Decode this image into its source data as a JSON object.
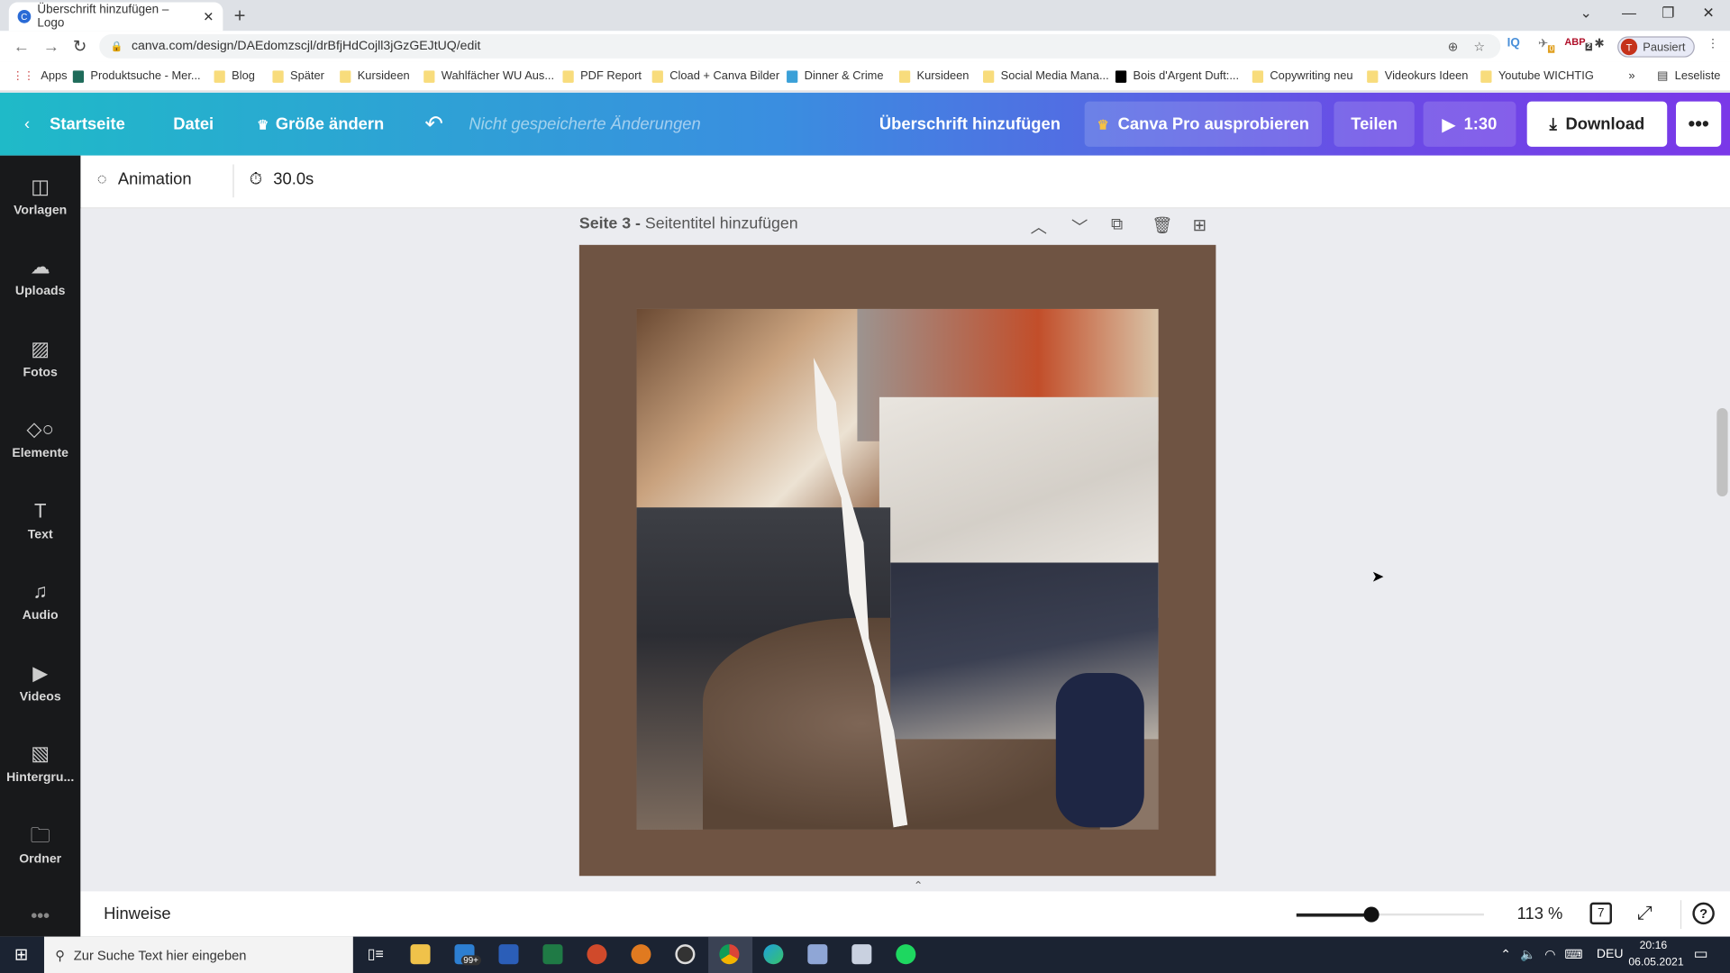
{
  "browser": {
    "tab_title": "Überschrift hinzufügen – Logo",
    "url": "canva.com/design/DAEdomzscjl/drBfjHdCojll3jGzGEJtUQ/edit",
    "profile_initial": "T",
    "profile_status": "Pausiert",
    "ext_badges": [
      "0",
      "2"
    ],
    "bookmarks": [
      "Apps",
      "Produktsuche - Mer...",
      "Blog",
      "Später",
      "Kursideen",
      "Wahlfächer WU Aus...",
      "PDF Report",
      "Cload + Canva Bilder",
      "Dinner & Crime",
      "Kursideen",
      "Social Media Mana...",
      "Bois d'Argent Duft:...",
      "Copywriting neu",
      "Videokurs Ideen",
      "Youtube WICHTIG"
    ],
    "reading_list": "Leseliste"
  },
  "header": {
    "home": "Startseite",
    "file": "Datei",
    "resize": "Größe ändern",
    "unsaved": "Nicht gespeicherte Änderungen",
    "title": "Überschrift hinzufügen",
    "pro": "Canva Pro ausprobieren",
    "share": "Teilen",
    "play_duration": "1:30",
    "download": "Download"
  },
  "toolbar": {
    "animation": "Animation",
    "duration": "30.0s"
  },
  "sidebar": {
    "items": [
      {
        "label": "Vorlagen",
        "icon": "templates-icon"
      },
      {
        "label": "Uploads",
        "icon": "upload-icon"
      },
      {
        "label": "Fotos",
        "icon": "photo-icon"
      },
      {
        "label": "Elemente",
        "icon": "elements-icon"
      },
      {
        "label": "Text",
        "icon": "text-icon"
      },
      {
        "label": "Audio",
        "icon": "music-icon"
      },
      {
        "label": "Videos",
        "icon": "video-icon"
      },
      {
        "label": "Hintergru...",
        "icon": "background-icon"
      },
      {
        "label": "Ordner",
        "icon": "folder-icon"
      }
    ]
  },
  "page": {
    "number": "Seite 3 -",
    "title_placeholder": "Seitentitel hinzufügen",
    "background": "#6f5443"
  },
  "bottom": {
    "notes": "Hinweise",
    "zoom": "113 %",
    "zoom_percent": 113,
    "page_count": "7"
  },
  "taskbar": {
    "search_placeholder": "Zur Suche Text hier eingeben",
    "mail_badge": "99+",
    "lang": "DEU",
    "time": "20:16",
    "date": "06.05.2021"
  }
}
